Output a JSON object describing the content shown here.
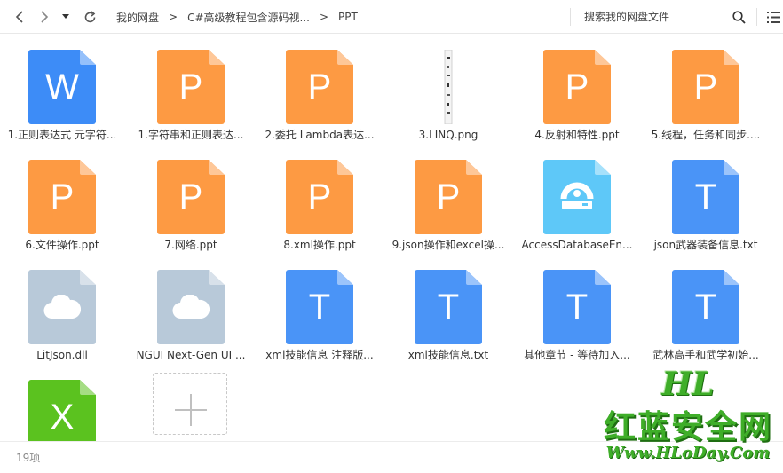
{
  "toolbar": {
    "back_icon": "chevron-left-icon",
    "forward_icon": "chevron-right-icon",
    "history_icon": "caret-down-icon",
    "refresh_icon": "refresh-icon",
    "breadcrumb": [
      "我的网盘",
      "C#高级教程包含源码视...",
      "PPT"
    ],
    "breadcrumb_separator": ">",
    "search_placeholder": "搜索我的网盘文件",
    "search_icon": "search-icon",
    "view_icon": "list-view-icon"
  },
  "files": [
    {
      "name": "1.正则表达式 元字符...",
      "type": "word",
      "letter": "W",
      "color": "#3d8cf7"
    },
    {
      "name": "1.字符串和正则表达...",
      "type": "ppt",
      "letter": "P",
      "color": "#fd9a43"
    },
    {
      "name": "2.委托 Lambda表达...",
      "type": "ppt",
      "letter": "P",
      "color": "#fd9a43"
    },
    {
      "name": "3.LINQ.png",
      "type": "image",
      "letter": "",
      "color": "#cccccc"
    },
    {
      "name": "4.反射和特性.ppt",
      "type": "ppt",
      "letter": "P",
      "color": "#fd9a43"
    },
    {
      "name": "5.线程，任务和同步....",
      "type": "ppt",
      "letter": "P",
      "color": "#fd9a43"
    },
    {
      "name": "6.文件操作.ppt",
      "type": "ppt",
      "letter": "P",
      "color": "#fd9a43"
    },
    {
      "name": "7.网络.ppt",
      "type": "ppt",
      "letter": "P",
      "color": "#fd9a43"
    },
    {
      "name": "8.xml操作.ppt",
      "type": "ppt",
      "letter": "P",
      "color": "#fd9a43"
    },
    {
      "name": "9.json操作和excel操...",
      "type": "ppt",
      "letter": "P",
      "color": "#fd9a43"
    },
    {
      "name": "AccessDatabaseEn...",
      "type": "exe",
      "letter": "",
      "color": "#5ec8f8"
    },
    {
      "name": "json武器装备信息.txt",
      "type": "txt",
      "letter": "T",
      "color": "#4a94f7"
    },
    {
      "name": "LitJson.dll",
      "type": "dll",
      "letter": "",
      "color": "#b8c9d9"
    },
    {
      "name": "NGUI Next-Gen UI ...",
      "type": "dll",
      "letter": "",
      "color": "#b8c9d9"
    },
    {
      "name": "xml技能信息 注释版...",
      "type": "txt",
      "letter": "T",
      "color": "#4a94f7"
    },
    {
      "name": "xml技能信息.txt",
      "type": "txt",
      "letter": "T",
      "color": "#4a94f7"
    },
    {
      "name": "其他章节 - 等待加入...",
      "type": "txt",
      "letter": "T",
      "color": "#4a94f7"
    },
    {
      "name": "武林高手和武学初始...",
      "type": "txt",
      "letter": "T",
      "color": "#4a94f7"
    },
    {
      "name": "",
      "type": "excel",
      "letter": "X",
      "color": "#5bc21f"
    }
  ],
  "add_tile_icon": "plus-icon",
  "status": {
    "count": "19项"
  },
  "watermark": {
    "line1": "HL",
    "line2": "红蓝安全网",
    "line3": "Www.HLoDay.Com"
  }
}
